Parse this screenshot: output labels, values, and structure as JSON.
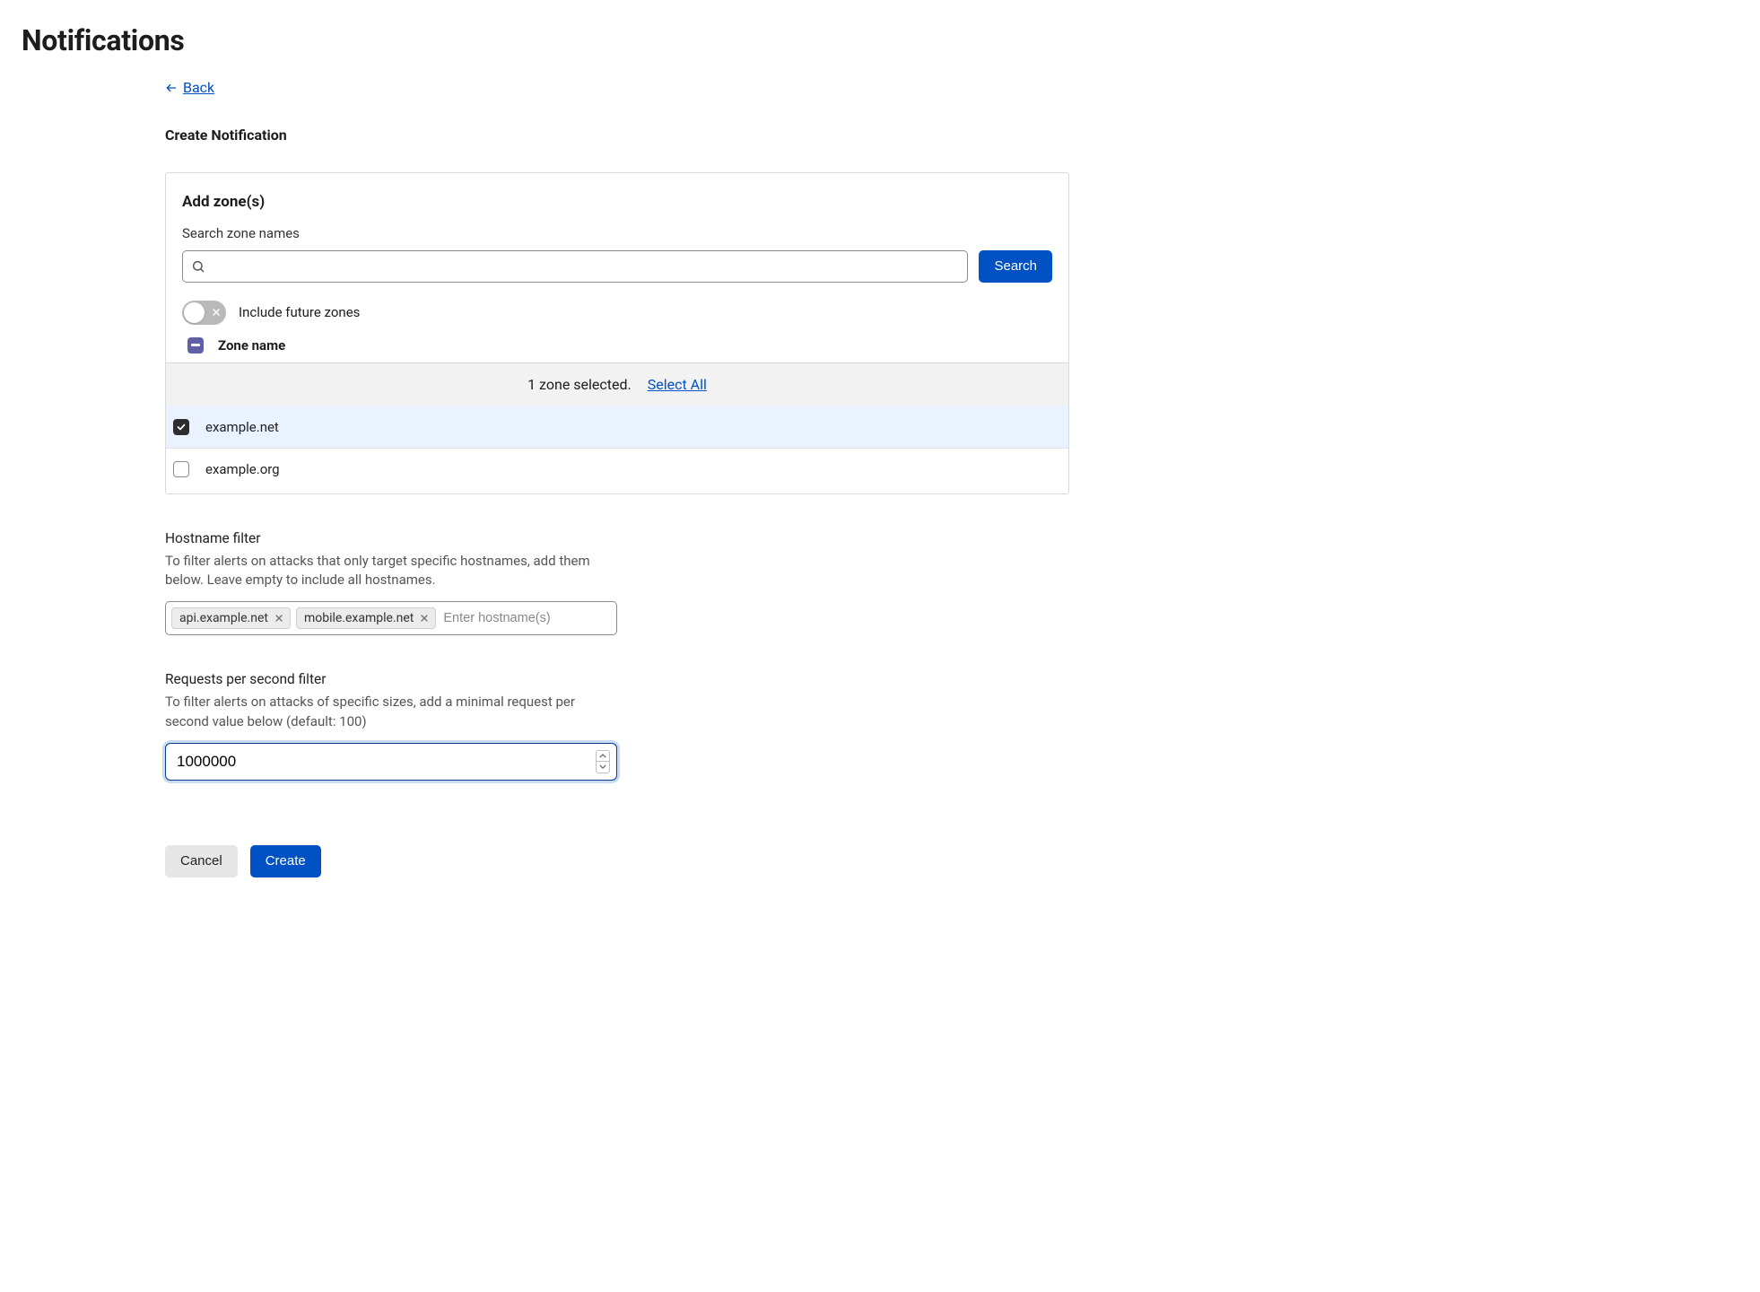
{
  "page_title": "Notifications",
  "back": {
    "label": "Back"
  },
  "subtitle": "Create Notification",
  "card": {
    "title": "Add zone(s)",
    "search_label": "Search zone names",
    "search_value": "",
    "search_button": "Search",
    "include_future": {
      "label": "Include future zones",
      "on": false
    },
    "column_header": "Zone name",
    "banner": {
      "text": "1 zone selected.",
      "select_all": "Select All"
    },
    "zones": [
      {
        "name": "example.net",
        "checked": true
      },
      {
        "name": "example.org",
        "checked": false
      }
    ]
  },
  "hostname": {
    "title": "Hostname filter",
    "desc": "To filter alerts on attacks that only target specific hostnames, add them below. Leave empty to include all hostnames.",
    "tags": [
      "api.example.net",
      "mobile.example.net"
    ],
    "placeholder": "Enter hostname(s)"
  },
  "rps": {
    "title": "Requests per second filter",
    "desc": "To filter alerts on attacks of specific sizes, add a minimal request per second value below (default: 100)",
    "value": "1000000"
  },
  "actions": {
    "cancel": "Cancel",
    "create": "Create"
  },
  "colors": {
    "primary": "#0051c3"
  }
}
